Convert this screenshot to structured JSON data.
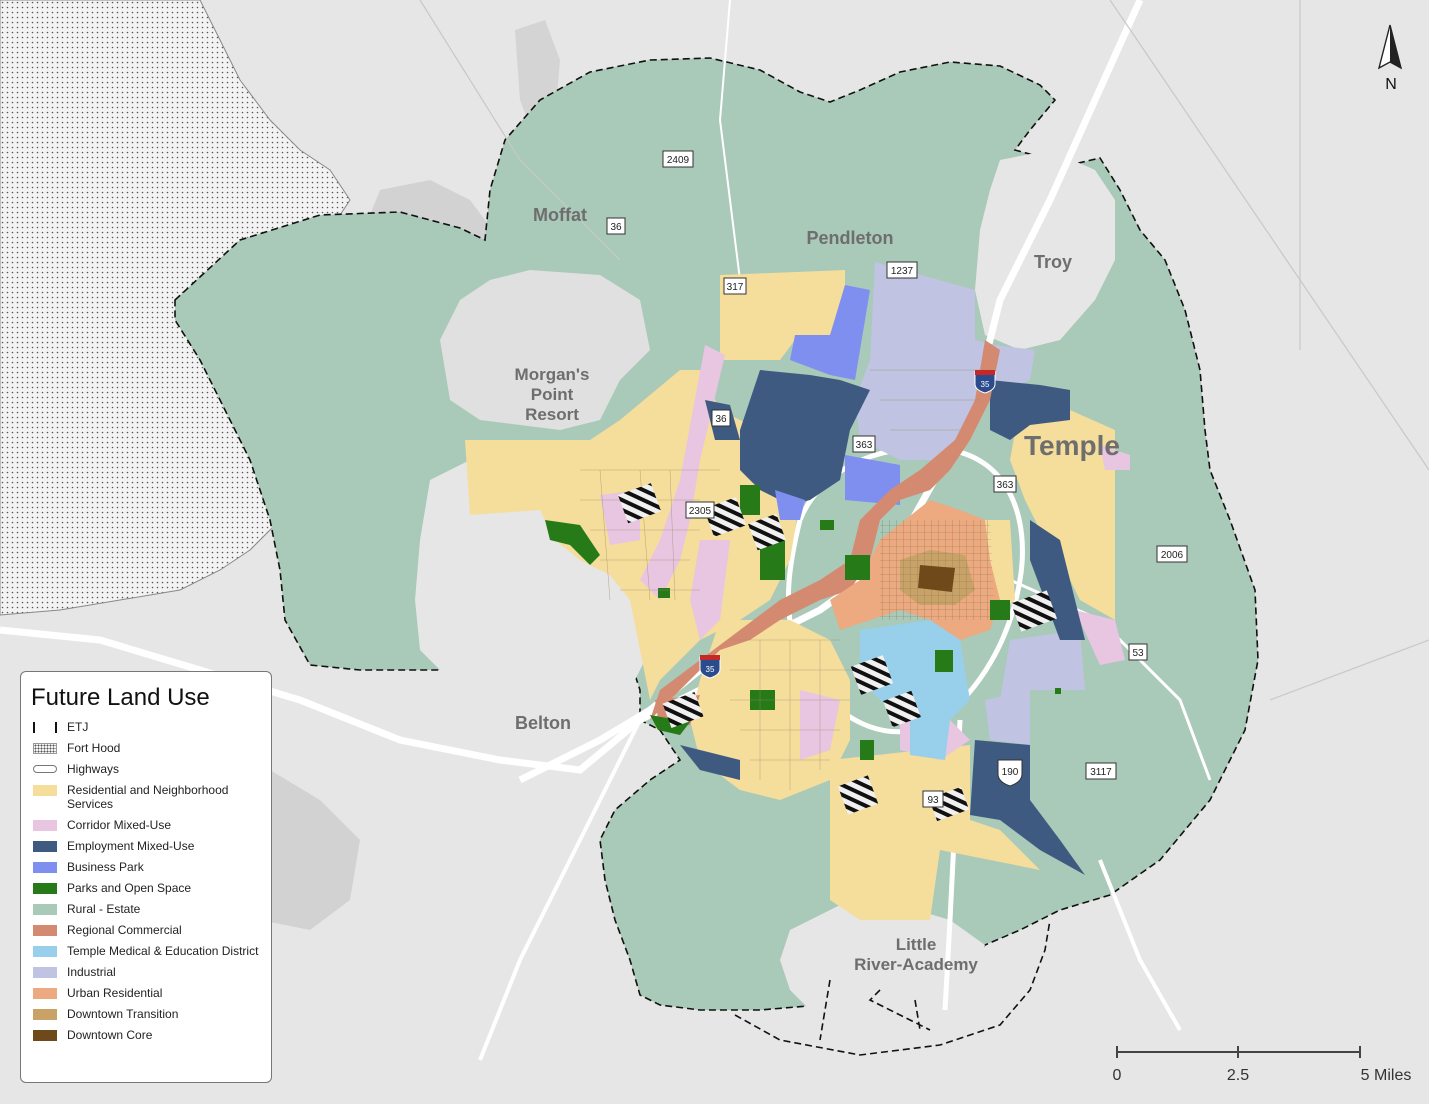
{
  "map": {
    "towns": {
      "moffat": "Moffat",
      "pendleton": "Pendleton",
      "troy": "Troy",
      "morgans_point_1": "Morgan's",
      "morgans_point_2": "Point",
      "morgans_point_3": "Resort",
      "temple": "Temple",
      "belton": "Belton",
      "little_river_1": "Little",
      "little_river_2": "River-Academy"
    },
    "route_shields": {
      "r2409": "2409",
      "r36a": "36",
      "r1237": "1237",
      "r317": "317",
      "r36b": "36",
      "r363a": "363",
      "r363b": "363",
      "r2305": "2305",
      "r2006": "2006",
      "r53": "53",
      "r3117": "3117",
      "r190": "190",
      "r93": "93",
      "i35a": "35",
      "i35b": "35"
    },
    "north_arrow": "N",
    "scale": {
      "s0": "0",
      "s1": "2.5",
      "s2": "5 Miles"
    },
    "colors": {
      "background": "#e8e8e8",
      "etj_line": "#111111",
      "residential": "#f5dd9b",
      "corridor_mixed_use": "#e8c5e0",
      "employment_mixed_use": "#3e5a80",
      "business_park": "#7f8ff0",
      "parks": "#277a18",
      "rural_estate": "#a9c9b9",
      "regional_commercial": "#d48a70",
      "medical_education": "#98cfea",
      "industrial": "#c0c3e2",
      "urban_residential": "#eda97f",
      "downtown_transition": "#c8a266",
      "downtown_core": "#6e4a1a"
    }
  },
  "legend": {
    "title": "Future Land Use",
    "items": [
      {
        "label": "ETJ",
        "swatch": "etj"
      },
      {
        "label": "Fort Hood",
        "swatch": "hood"
      },
      {
        "label": "Highways",
        "swatch": "hwy"
      },
      {
        "label": "Residential and Neighborhood Services",
        "color": "#f5dd9b"
      },
      {
        "label": "Corridor Mixed-Use",
        "color": "#e8c5e0"
      },
      {
        "label": "Employment Mixed-Use",
        "color": "#3e5a80"
      },
      {
        "label": "Business Park",
        "color": "#7f8ff0"
      },
      {
        "label": "Parks and Open Space",
        "color": "#277a18"
      },
      {
        "label": "Rural - Estate",
        "color": "#a9c9b9"
      },
      {
        "label": "Regional Commercial",
        "color": "#d48a70"
      },
      {
        "label": "Temple Medical & Education District",
        "color": "#98cfea"
      },
      {
        "label": "Industrial",
        "color": "#c0c3e2"
      },
      {
        "label": "Urban Residential",
        "color": "#eda97f"
      },
      {
        "label": "Downtown Transition",
        "color": "#c8a266"
      },
      {
        "label": "Downtown Core",
        "color": "#6e4a1a"
      }
    ]
  }
}
